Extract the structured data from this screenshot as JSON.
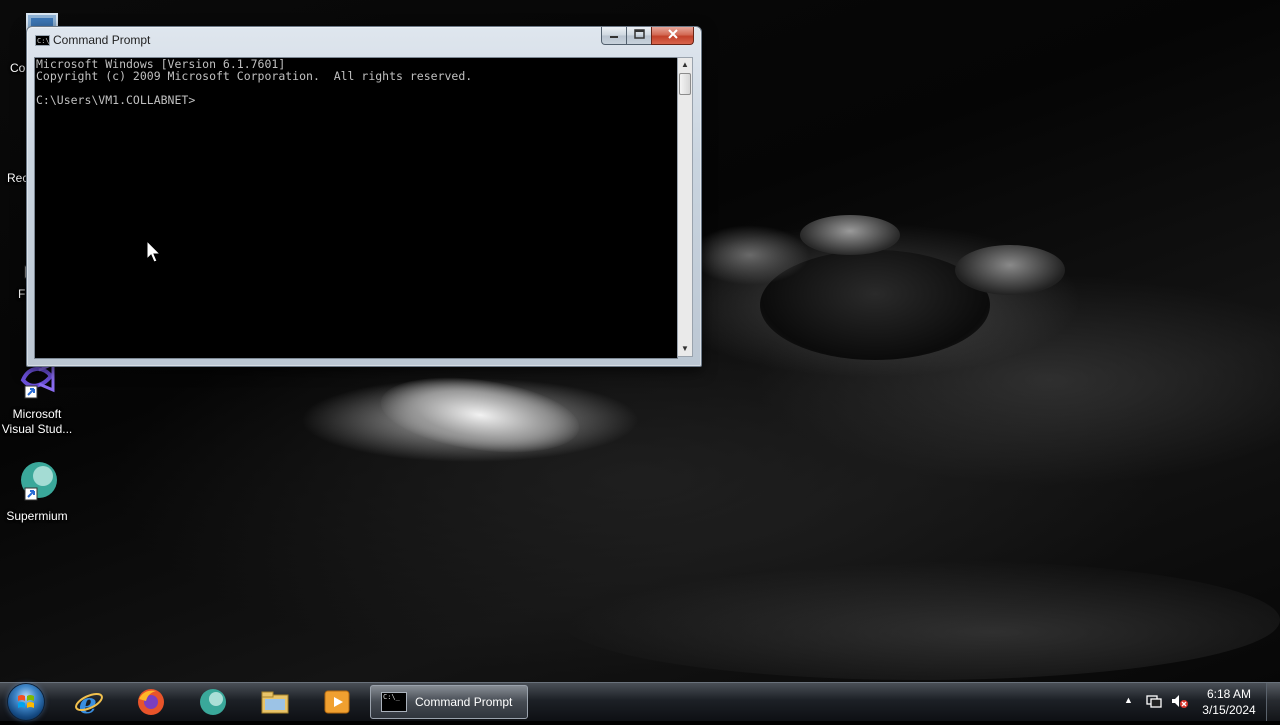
{
  "desktop": {
    "icons": [
      {
        "label": "Co",
        "icon": "computer-icon"
      },
      {
        "label": "Recy",
        "icon": "recycle-bin-icon"
      },
      {
        "label": "Fi",
        "icon": "firefox-shortcut-icon"
      },
      {
        "label_line1": "Microsoft",
        "label_line2": "Visual Stud...",
        "icon": "visual-studio-icon"
      },
      {
        "label": "Supermium",
        "icon": "supermium-icon"
      }
    ]
  },
  "cmd_window": {
    "title": "Command Prompt",
    "console_text": "Microsoft Windows [Version 6.1.7601]\nCopyright (c) 2009 Microsoft Corporation.  All rights reserved.\n\nC:\\Users\\VM1.COLLABNET>",
    "buttons": {
      "minimize": "minimize-icon",
      "maximize": "maximize-icon",
      "close": "close-icon"
    }
  },
  "taskbar": {
    "pinned": [
      {
        "name": "internet-explorer-icon"
      },
      {
        "name": "firefox-icon"
      },
      {
        "name": "supermium-icon"
      },
      {
        "name": "file-explorer-icon"
      },
      {
        "name": "media-player-icon"
      }
    ],
    "active_task_label": "Command Prompt",
    "clock_time": "6:18 AM",
    "clock_date": "3/15/2024"
  },
  "colors": {
    "console_bg": "#000000",
    "console_fg": "#c0c0c0",
    "close_button": "#c2412a"
  }
}
